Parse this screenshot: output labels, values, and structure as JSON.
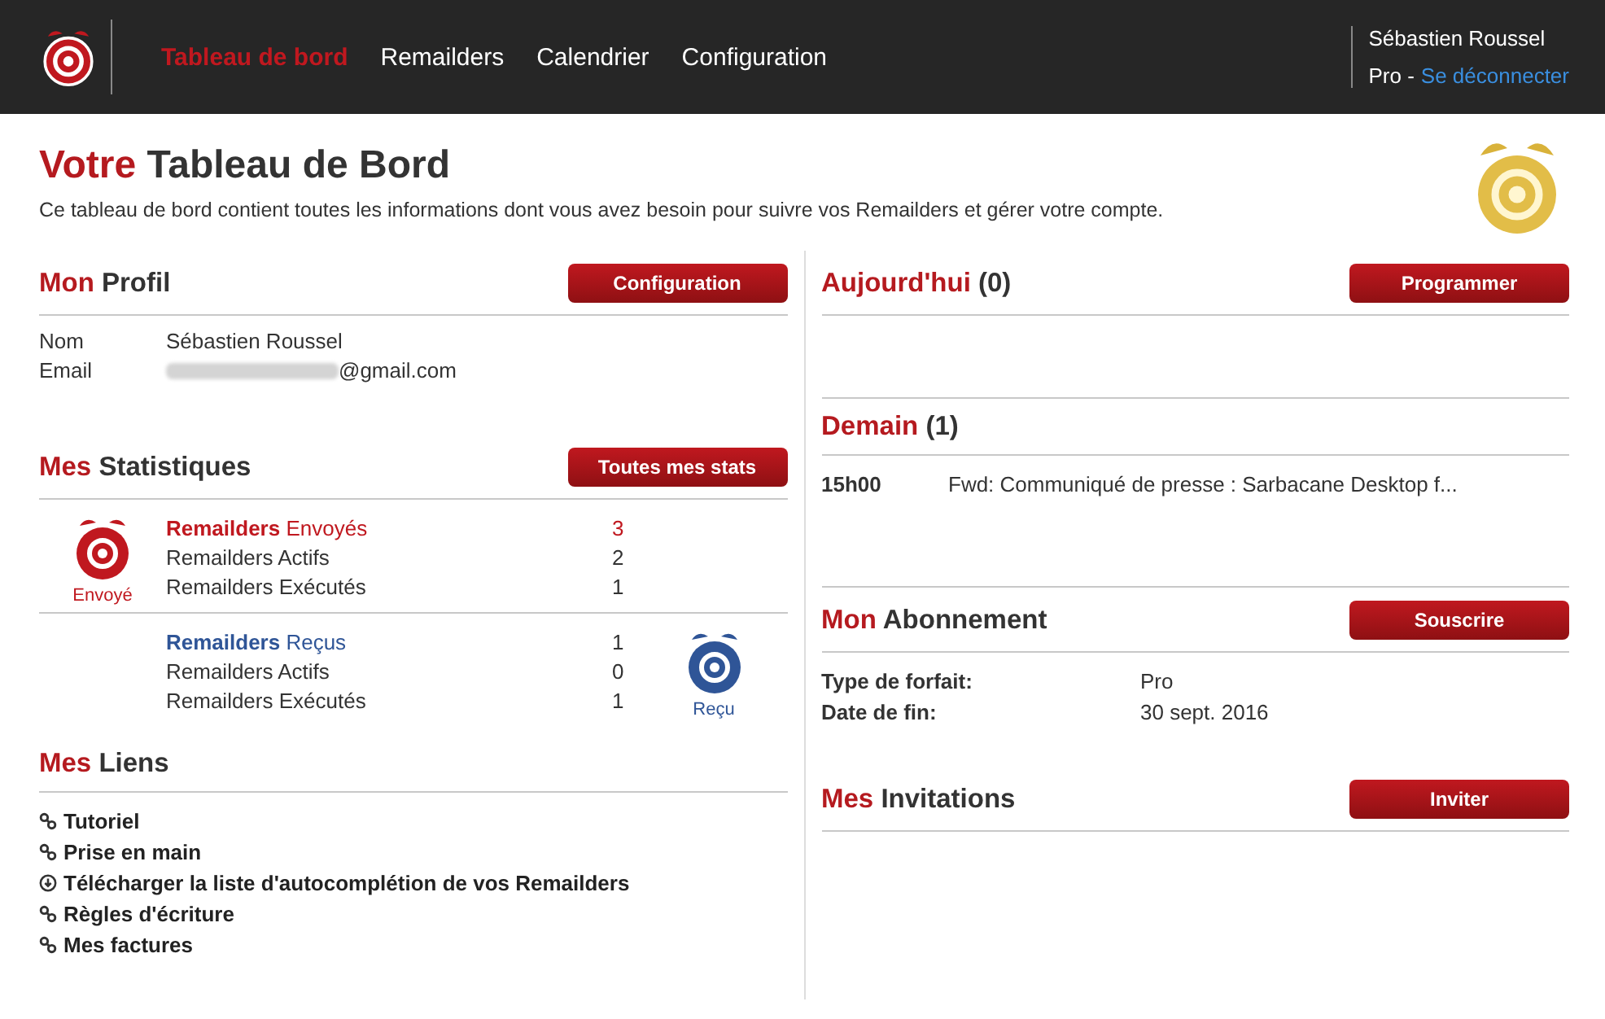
{
  "nav": {
    "items": [
      {
        "label": "Tableau de bord",
        "selected": true
      },
      {
        "label": "Remailders",
        "selected": false
      },
      {
        "label": "Calendrier",
        "selected": false
      },
      {
        "label": "Configuration",
        "selected": false
      }
    ],
    "user": {
      "name": "Sébastien Roussel",
      "plan": "Pro -",
      "logout": "Se déconnecter"
    }
  },
  "page": {
    "title_accent": "Votre",
    "title_rest": "Tableau de Bord",
    "intro": "Ce tableau de bord contient toutes les informations dont vous avez besoin pour suivre vos Remailders et gérer votre compte."
  },
  "profile": {
    "title_accent": "Mon",
    "title_rest": "Profil",
    "button": "Configuration",
    "fields": [
      {
        "label": "Nom",
        "value": "Sébastien Roussel",
        "redacted": false
      },
      {
        "label": "Email",
        "value": "@gmail.com",
        "redacted": true
      }
    ]
  },
  "stats": {
    "title_accent": "Mes",
    "title_rest": "Statistiques",
    "button": "Toutes mes stats",
    "groups": [
      {
        "kind": "sent",
        "icon_label": "Envoyé",
        "color": "#c0181f",
        "rows": [
          {
            "label": "**Remailders** Envoyés",
            "value": "3"
          },
          {
            "label": "Remailders Actifs",
            "value": "2"
          },
          {
            "label": "Remailders Exécutés",
            "value": "1"
          }
        ]
      },
      {
        "kind": "received",
        "icon_label": "Reçu",
        "color": "#2f5597",
        "rows": [
          {
            "label": "**Remailders** Reçus",
            "value": "1"
          },
          {
            "label": "Remailders Actifs",
            "value": "0"
          },
          {
            "label": "Remailders Exécutés",
            "value": "1"
          }
        ]
      }
    ]
  },
  "links": {
    "title_accent": "Mes",
    "title_rest": "Liens",
    "items": [
      {
        "kind": "link",
        "label": "Tutoriel"
      },
      {
        "kind": "link",
        "label": "Prise en main"
      },
      {
        "kind": "download",
        "label": "Télécharger la liste d'autocomplétion de vos Remailders"
      },
      {
        "kind": "link",
        "label": "Règles d'écriture"
      },
      {
        "kind": "link",
        "label": "Mes factures"
      }
    ]
  },
  "today": {
    "title": "Aujourd'hui",
    "count": "(0)",
    "button": "Programmer"
  },
  "tomorrow": {
    "title": "Demain",
    "count": "(1)",
    "items": [
      {
        "time": "15h00",
        "subject": "Fwd: Communiqué de presse : Sarbacane Desktop f..."
      }
    ]
  },
  "subscription": {
    "title_accent": "Mon",
    "title_rest": "Abonnement",
    "button": "Souscrire",
    "fields": [
      {
        "label": "Type de forfait:",
        "value": "Pro"
      },
      {
        "label": "Date de fin:",
        "value": "30 sept. 2016"
      }
    ]
  },
  "invitations": {
    "title_accent": "Mes",
    "title_rest": "Invitations",
    "button": "Inviter"
  }
}
